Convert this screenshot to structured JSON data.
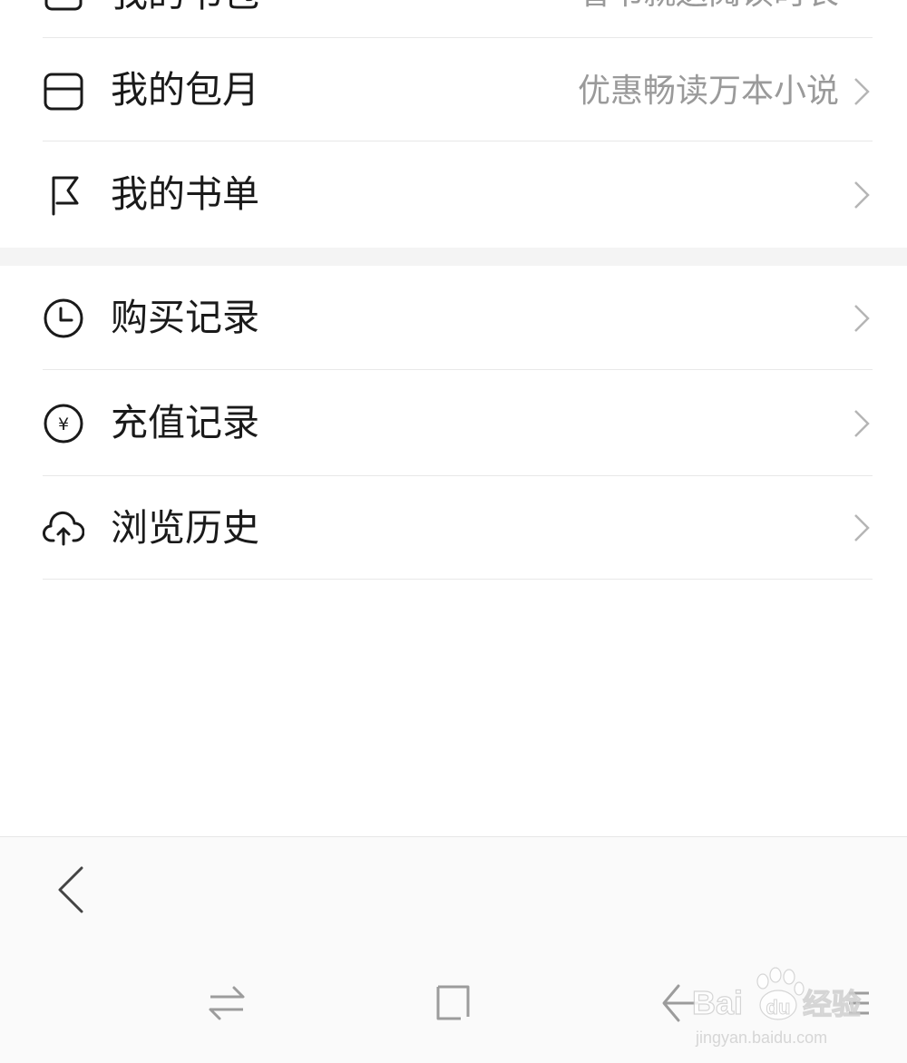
{
  "menu_group_1": {
    "partial_top_label": "我的书包",
    "partial_top_subtitle": "看书就送阅读时长",
    "items": [
      {
        "label": "我的包月",
        "subtitle": "优惠畅读万本小说",
        "icon": "card-icon"
      },
      {
        "label": "我的书单",
        "subtitle": "",
        "icon": "flag-icon"
      }
    ]
  },
  "menu_group_2": {
    "items": [
      {
        "label": "购买记录",
        "icon": "clock-icon"
      },
      {
        "label": "充值记录",
        "icon": "yuan-icon"
      },
      {
        "label": "浏览历史",
        "icon": "cloud-upload-icon"
      }
    ]
  },
  "bottom_bar": {
    "back_icon": "chevron-left-icon",
    "nav_icons": [
      "switch-icon",
      "square-icon",
      "back-arrow-icon",
      "menu-icon"
    ]
  },
  "watermark": {
    "brand": "Bai",
    "brand_paw": "du",
    "product": "经验",
    "url": "jingyan.baidu.com"
  },
  "colors": {
    "text": "#1a1a1a",
    "subtitle": "#9a9a9a",
    "chevron": "#b5b5b5",
    "divider": "#e8e8e8",
    "section_gap": "#f4f4f4",
    "nav_icon": "#9c9c9c"
  }
}
